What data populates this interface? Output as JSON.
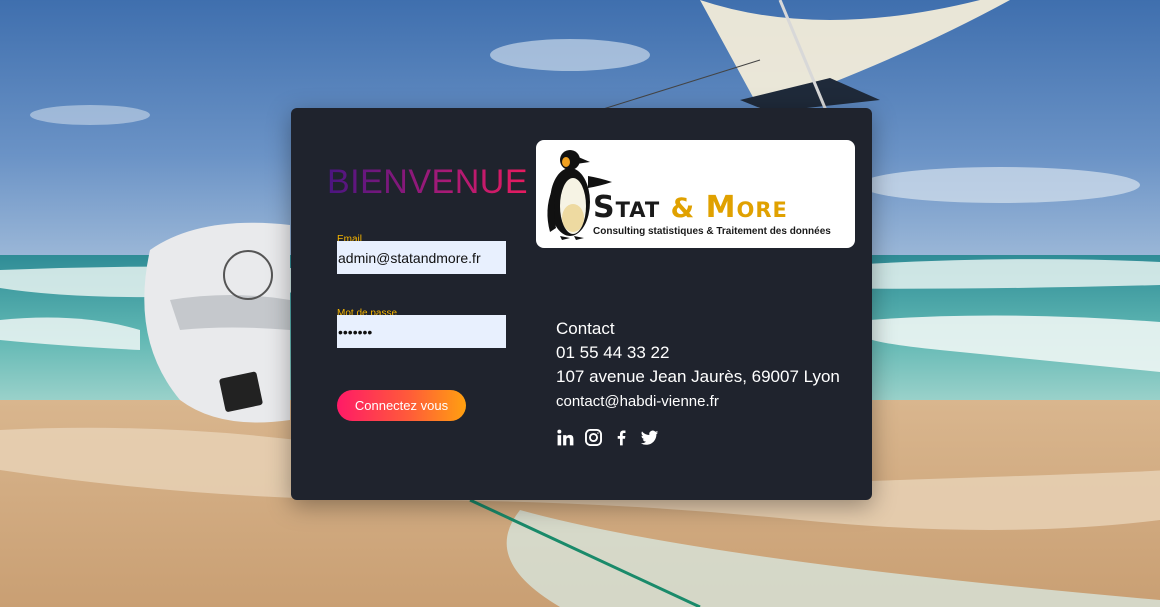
{
  "welcome": "BIENVENUE",
  "form": {
    "email_label": "Email",
    "email_value": "admin@statandmore.fr",
    "password_label": "Mot de passe",
    "password_value": "•••••••",
    "submit_label": "Connectez vous"
  },
  "logo": {
    "title_left": "Stat",
    "title_amp": "&",
    "title_right": "More",
    "subtitle": "Consulting statistiques & Traitement des données"
  },
  "contact": {
    "heading": "Contact",
    "phone": "01 55 44 33 22",
    "address": "107 avenue Jean Jaurès, 69007 Lyon",
    "email": "contact@habdi-vienne.fr"
  },
  "socials": [
    {
      "icon": "linkedin-icon"
    },
    {
      "icon": "instagram-icon"
    },
    {
      "icon": "facebook-icon"
    },
    {
      "icon": "twitter-icon"
    }
  ],
  "colors": {
    "card_bg": "#1f232d",
    "label_accent": "#f5b400",
    "button_gradient_start": "#ff1a67",
    "button_gradient_end": "#ffa010",
    "welcome_gradient_start": "#4a1580",
    "welcome_gradient_end": "#e81b5f"
  }
}
